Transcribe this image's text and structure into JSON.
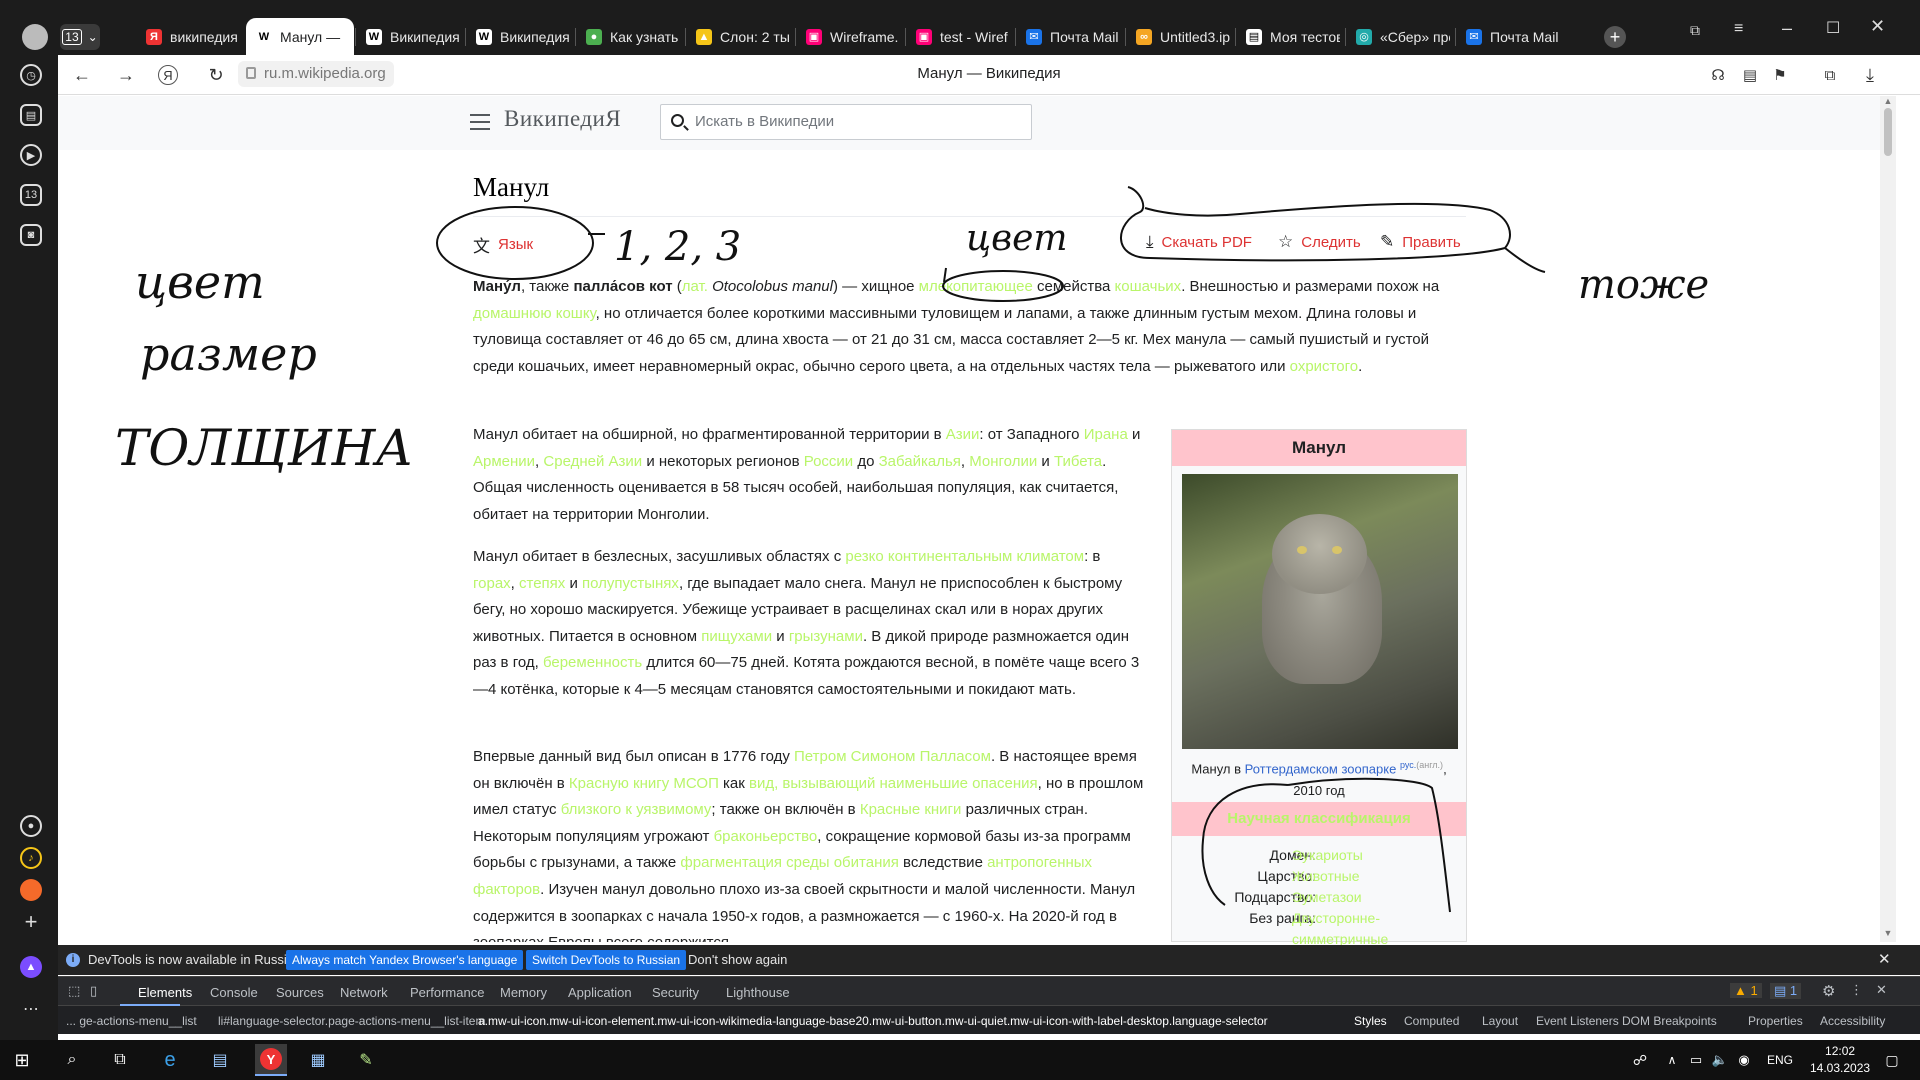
{
  "browser": {
    "tab_count": "13",
    "tabs": [
      {
        "label": "википедия",
        "icon": "Я"
      },
      {
        "label": "Манул —",
        "icon": "W"
      },
      {
        "label": "Википедия",
        "icon": "W"
      },
      {
        "label": "Википедия",
        "icon": "W"
      },
      {
        "label": "Как узнать",
        "icon": "●"
      },
      {
        "label": "Слон: 2 тыс",
        "icon": "▲"
      },
      {
        "label": "Wireframe.",
        "icon": "▣"
      },
      {
        "label": "test - Wiref",
        "icon": "▣"
      },
      {
        "label": "Почта Mail",
        "icon": "✉"
      },
      {
        "label": "Untitled3.ip",
        "icon": "∞"
      },
      {
        "label": "Моя тестов",
        "icon": "▤"
      },
      {
        "label": "«Сбер» пре",
        "icon": "◎"
      },
      {
        "label": "Почта Mail",
        "icon": "✉"
      }
    ],
    "url": "ru.m.wikipedia.org",
    "page_title": "Манул — Википедия"
  },
  "wiki": {
    "logo": "ВикипедиЯ",
    "search_placeholder": "Искать в Википедии",
    "title": "Манул",
    "actions": {
      "language": "Язык",
      "download": "Скачать PDF",
      "watch": "Следить",
      "edit": "Править"
    },
    "paragraphs": [
      [
        {
          "t": "Ману́л",
          "b": true
        },
        {
          "t": ", также "
        },
        {
          "t": "палла́сов кот",
          "b": true
        },
        {
          "t": " ("
        },
        {
          "t": "лат.",
          "a": true
        },
        {
          "t": " Otocolobus manul",
          "i": true
        },
        {
          "t": ") — хищное "
        },
        {
          "t": "млекопитающее",
          "a": true
        },
        {
          "t": " семейства "
        },
        {
          "t": "кошачьих",
          "a": true
        },
        {
          "t": ". Внешностью и размерами похож на "
        },
        {
          "t": "домашнюю кошку",
          "a": true
        },
        {
          "t": ", но отличается более короткими массивными туловищем и лапами, а также длинным густым мехом. Длина головы и туловища составляет от 46 до 65 см, длина хвоста — от 21 до 31 см, масса составляет 2—5 кг. Мех манула — самый пушистый и густой среди кошачьих, имеет неравномерный окрас, обычно серого цвета, а на отдельных частях тела — рыжеватого или "
        },
        {
          "t": "охристого",
          "a": true
        },
        {
          "t": "."
        }
      ],
      [
        {
          "t": "Манул обитает на обширной, но фрагментированной территории в "
        },
        {
          "t": "Азии",
          "a": true
        },
        {
          "t": ": от Западного "
        },
        {
          "t": "Ирана",
          "a": true
        },
        {
          "t": " и "
        },
        {
          "t": "Армении",
          "a": true
        },
        {
          "t": ", "
        },
        {
          "t": "Средней Азии",
          "a": true
        },
        {
          "t": " и некоторых регионов "
        },
        {
          "t": "России",
          "a": true
        },
        {
          "t": " до "
        },
        {
          "t": "Забайкалья",
          "a": true
        },
        {
          "t": ", "
        },
        {
          "t": "Монголии",
          "a": true
        },
        {
          "t": " и "
        },
        {
          "t": "Тибета",
          "a": true
        },
        {
          "t": ". Общая численность оценивается в 58 тысяч особей, наибольшая популяция, как считается, обитает на территории Монголии."
        }
      ],
      [
        {
          "t": "Манул обитает в безлесных, засушливых областях с "
        },
        {
          "t": "резко континентальным климатом",
          "a": true
        },
        {
          "t": ": в "
        },
        {
          "t": "горах",
          "a": true
        },
        {
          "t": ", "
        },
        {
          "t": "степях",
          "a": true
        },
        {
          "t": " и "
        },
        {
          "t": "полупустынях",
          "a": true
        },
        {
          "t": ", где выпадает мало снега. Манул не приспособлен к быстрому бегу, но хорошо маскируется. Убежище устраивает в расщелинах скал или в норах других животных. Питается в основном "
        },
        {
          "t": "пищухами",
          "a": true
        },
        {
          "t": " и "
        },
        {
          "t": "грызунами",
          "a": true
        },
        {
          "t": ". В дикой природе размножается один раз в год, "
        },
        {
          "t": "беременность",
          "a": true
        },
        {
          "t": " длится 60—75 дней. Котята рождаются весной, в помёте чаще всего 3—4 котёнка, которые к 4—5 месяцам становятся самостоятельными и покидают мать."
        }
      ],
      [
        {
          "t": "Впервые данный вид был описан в 1776 году "
        },
        {
          "t": "Петром Симоном Палласом",
          "a": true
        },
        {
          "t": ". В настоящее время он включён в "
        },
        {
          "t": "Красную книгу МСОП",
          "a": true
        },
        {
          "t": " как "
        },
        {
          "t": "вид, вызывающий наименьшие опасения",
          "a": true
        },
        {
          "t": ", но в прошлом имел статус "
        },
        {
          "t": "близкого к уязвимому",
          "a": true
        },
        {
          "t": "; также он включён в "
        },
        {
          "t": "Красные книги",
          "a": true
        },
        {
          "t": " различных стран. Некоторым популяциям угрожают "
        },
        {
          "t": "браконьерство",
          "a": true
        },
        {
          "t": ", сокращение кормовой базы из-за программ борьбы с грызунами, а также "
        },
        {
          "t": "фрагментация среды обитания",
          "a": true
        },
        {
          "t": " вследствие "
        },
        {
          "t": "антропогенных факторов",
          "a": true
        },
        {
          "t": ". Изучен манул довольно плохо из-за своей скрытности и малой численности. Манул содержится в зоопарках с начала 1950-х годов, а размножается — с 1960-х. На 2020-й год в зоопарках Европы всего содержится"
        }
      ]
    ],
    "infobox": {
      "title": "Манул",
      "caption_prefix": "Манул в ",
      "caption_link": "Роттердамском зоопарке",
      "caption_sup": "рус.",
      "caption_sup2": "(англ.)",
      "caption_year": "2010 год",
      "sci_header": "Научная классификация",
      "taxonomy": [
        {
          "k": "Домен:",
          "v": "Эукариоты"
        },
        {
          "k": "Царство:",
          "v": "Животные"
        },
        {
          "k": "Подцарство:",
          "v": "Эуметазои"
        },
        {
          "k": "Без ранга:",
          "v": "Двусторонне-"
        },
        {
          "k": "",
          "v": "симметричные"
        }
      ]
    }
  },
  "annotations": {
    "left1": "цвет",
    "left2": "размер",
    "left3": "ТОЛЩИНА",
    "lang_note": "1, 2, 3",
    "mid": "цвет",
    "right": "тоже"
  },
  "devtools": {
    "info_text": "DevTools is now available in Russian!",
    "btn_match": "Always match Yandex Browser's language",
    "btn_switch": "Switch DevTools to Russian",
    "dont_show": "Don't show again",
    "tabs": [
      "Elements",
      "Console",
      "Sources",
      "Network",
      "Performance",
      "Memory",
      "Application",
      "Security",
      "Lighthouse"
    ],
    "warn_count": "1",
    "msg_count": "1",
    "crumb1": "...  ge-actions-menu__list",
    "crumb2": "li#language-selector.page-actions-menu__list-item",
    "crumb3": "a.mw-ui-icon.mw-ui-icon-element.mw-ui-icon-wikimedia-language-base20.mw-ui-button.mw-ui-quiet.mw-ui-icon-with-label-desktop.language-selector",
    "side_tabs": [
      "Styles",
      "Computed",
      "Layout",
      "Event Listeners",
      "DOM Breakpoints",
      "Properties",
      "Accessibility"
    ]
  },
  "taskbar": {
    "lang": "ENG",
    "time": "12:02",
    "date": "14.03.2023"
  }
}
